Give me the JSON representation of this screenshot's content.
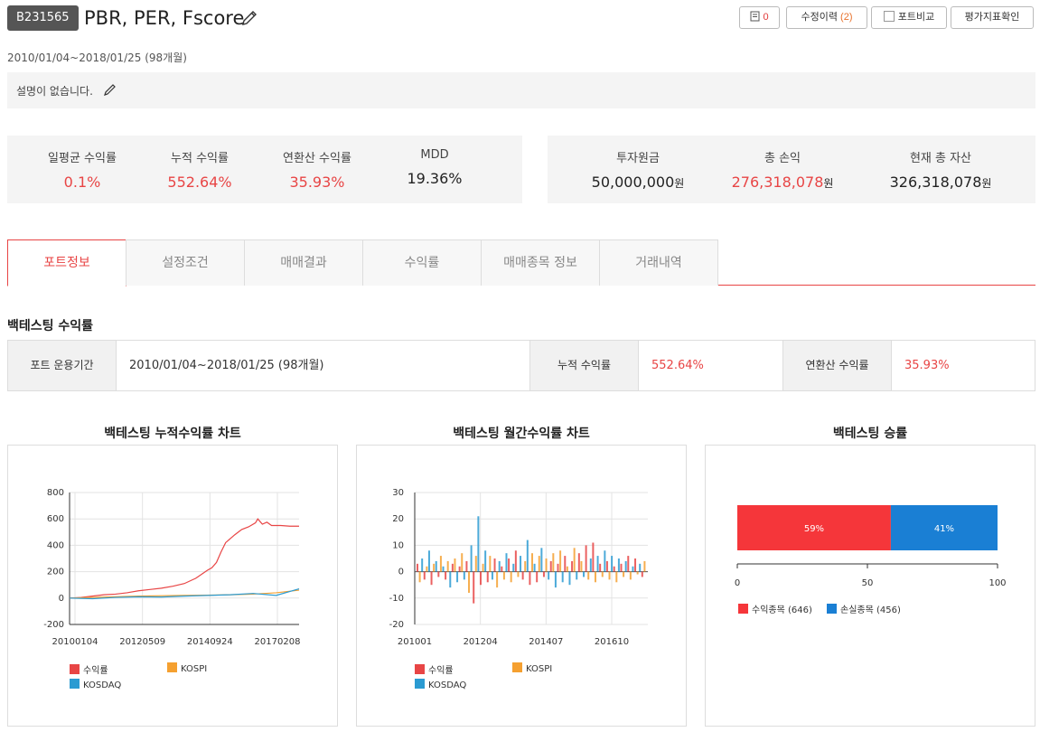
{
  "header": {
    "code": "B231565",
    "title": "PBR, PER, Fscore",
    "buttons": {
      "memo_count": "0",
      "history_label": "수정이력",
      "history_count": "(2)",
      "compare_label": "포트비교",
      "eval_label": "평가지표확인"
    }
  },
  "period": "2010/01/04~2018/01/25 (98개월)",
  "description": "설명이 없습니다.",
  "stats_left": [
    {
      "label": "일평균 수익률",
      "value": "0.1%",
      "red": true
    },
    {
      "label": "누적 수익률",
      "value": "552.64%",
      "red": true
    },
    {
      "label": "연환산 수익률",
      "value": "35.93%",
      "red": true
    },
    {
      "label": "MDD",
      "value": "19.36%",
      "red": false
    }
  ],
  "stats_right": [
    {
      "label": "투자원금",
      "value": "50,000,000",
      "unit": "원",
      "red": false
    },
    {
      "label": "총 손익",
      "value": "276,318,078",
      "unit": "원",
      "red": true
    },
    {
      "label": "현재 총 자산",
      "value": "326,318,078",
      "unit": "원",
      "red": false
    }
  ],
  "tabs": [
    "포트정보",
    "설정조건",
    "매매결과",
    "수익률",
    "매매종목 정보",
    "거래내역"
  ],
  "section_title": "백테스팅 수익률",
  "summary": {
    "period_label": "포트 운용기간",
    "period_value": "2010/01/04~2018/01/25 (98개월)",
    "cum_label": "누적 수익률",
    "cum_value": "552.64%",
    "annual_label": "연환산 수익률",
    "annual_value": "35.93%"
  },
  "colors": {
    "red": "#e84545",
    "orange": "#f5a030",
    "blue": "#2b9bd2",
    "win": "#f5363a",
    "loss": "#1a7fd4"
  },
  "chart_data": [
    {
      "type": "line",
      "title": "백테스팅 누적수익률 차트",
      "x_ticks": [
        "20100104",
        "20120509",
        "20140924",
        "20170208"
      ],
      "ylim": [
        -200,
        800
      ],
      "y_ticks": [
        "800",
        "600",
        "400",
        "200",
        "0",
        "-200"
      ],
      "grid": true,
      "legend": "bottom",
      "series": [
        {
          "name": "수익률",
          "color": "#e84545",
          "points": [
            [
              0,
              0
            ],
            [
              0.05,
              5
            ],
            [
              0.1,
              15
            ],
            [
              0.15,
              25
            ],
            [
              0.2,
              30
            ],
            [
              0.25,
              40
            ],
            [
              0.3,
              55
            ],
            [
              0.35,
              65
            ],
            [
              0.4,
              75
            ],
            [
              0.45,
              90
            ],
            [
              0.5,
              110
            ],
            [
              0.55,
              150
            ],
            [
              0.6,
              210
            ],
            [
              0.62,
              230
            ],
            [
              0.64,
              270
            ],
            [
              0.66,
              350
            ],
            [
              0.68,
              420
            ],
            [
              0.7,
              450
            ],
            [
              0.72,
              480
            ],
            [
              0.75,
              520
            ],
            [
              0.78,
              540
            ],
            [
              0.81,
              570
            ],
            [
              0.82,
              600
            ],
            [
              0.84,
              560
            ],
            [
              0.86,
              575
            ],
            [
              0.88,
              550
            ],
            [
              0.92,
              550
            ],
            [
              0.96,
              545
            ],
            [
              1,
              545
            ]
          ]
        },
        {
          "name": "KOSPI",
          "color": "#f5a030",
          "points": [
            [
              0,
              0
            ],
            [
              0.1,
              5
            ],
            [
              0.2,
              10
            ],
            [
              0.3,
              15
            ],
            [
              0.4,
              18
            ],
            [
              0.5,
              20
            ],
            [
              0.6,
              22
            ],
            [
              0.7,
              25
            ],
            [
              0.8,
              30
            ],
            [
              0.9,
              40
            ],
            [
              1,
              60
            ]
          ]
        },
        {
          "name": "KOSDAQ",
          "color": "#2b9bd2",
          "points": [
            [
              0,
              0
            ],
            [
              0.1,
              -5
            ],
            [
              0.2,
              5
            ],
            [
              0.3,
              10
            ],
            [
              0.4,
              8
            ],
            [
              0.5,
              15
            ],
            [
              0.6,
              20
            ],
            [
              0.7,
              25
            ],
            [
              0.8,
              35
            ],
            [
              0.9,
              20
            ],
            [
              1,
              70
            ]
          ]
        }
      ]
    },
    {
      "type": "bar",
      "title": "백테스팅 월간수익률 차트",
      "x_ticks": [
        "201001",
        "201204",
        "201407",
        "201610"
      ],
      "ylim": [
        -20,
        30
      ],
      "y_ticks": [
        "30",
        "20",
        "10",
        "0",
        "-10",
        "-20"
      ],
      "grid": true,
      "legend": "bottom",
      "series_names": [
        "수익률",
        "KOSPI",
        "KOSDAQ"
      ],
      "months": 98,
      "values": [
        [
          3,
          -4,
          5,
          -3,
          2,
          8,
          -5,
          3,
          4,
          -2,
          6,
          2,
          -3,
          4,
          -6,
          3,
          5,
          -4,
          2,
          7,
          -3,
          4,
          -8,
          10,
          -12,
          6,
          21,
          -5,
          3,
          8,
          -4,
          6,
          -3,
          5,
          -6,
          4,
          2,
          -3,
          7,
          5,
          -4,
          3,
          8,
          -2,
          6,
          -3,
          4,
          12,
          -5,
          7,
          3,
          -4,
          6,
          9,
          -2,
          5,
          -3,
          4,
          7,
          -6,
          3,
          8,
          -4,
          6,
          2,
          -5,
          4,
          9,
          -3,
          7,
          4,
          -2,
          10,
          -3,
          5,
          11,
          -4,
          6,
          3,
          -2,
          8,
          4,
          -3,
          6,
          2,
          -4,
          5,
          3,
          -2,
          4,
          6,
          -3,
          2,
          5,
          -1,
          3,
          -2,
          4
        ]
      ]
    },
    {
      "type": "bar",
      "title": "백테스팅 승률",
      "orientation": "horizontal",
      "stacked": true,
      "xlim": [
        0,
        100
      ],
      "x_ticks": [
        "0",
        "50",
        "100"
      ],
      "legend": "bottom",
      "categories": [
        ""
      ],
      "series": [
        {
          "name": "수익종목 (646)",
          "label": "59%",
          "values": [
            59
          ],
          "color": "#f5363a"
        },
        {
          "name": "손실종목 (456)",
          "label": "41%",
          "values": [
            41
          ],
          "color": "#1a7fd4"
        }
      ]
    }
  ]
}
